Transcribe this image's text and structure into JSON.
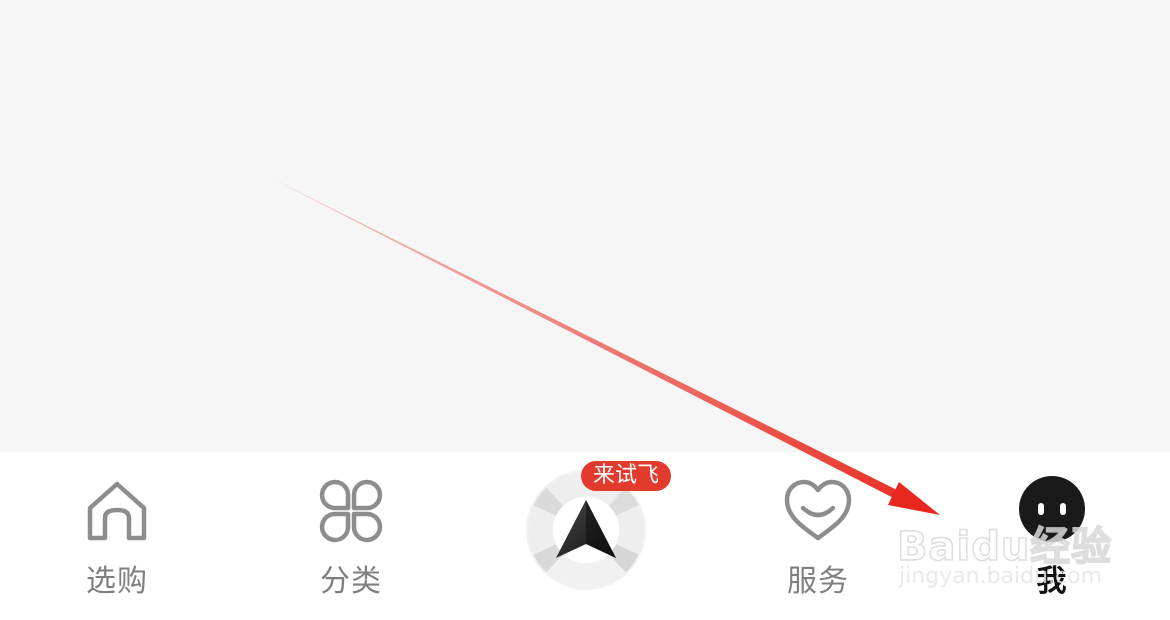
{
  "tabbar": {
    "items": [
      {
        "id": "home",
        "label": "选购",
        "icon": "home-icon",
        "active": false
      },
      {
        "id": "category",
        "label": "分类",
        "icon": "four-petal-grid-icon",
        "active": false
      },
      {
        "id": "center",
        "badge": "来试飞",
        "icon": "navigation-arrow-icon"
      },
      {
        "id": "service",
        "label": "服务",
        "icon": "heart-smile-icon",
        "active": false
      },
      {
        "id": "me",
        "label": "我",
        "icon": "avatar-face-icon",
        "active": true
      }
    ]
  },
  "watermark": {
    "brand": "Baidu经验",
    "url": "jingyan.baidu.com"
  },
  "colors": {
    "background": "#f6f6f6",
    "tabbar": "#ffffff",
    "inactive_label": "#7f7f7f",
    "active_label": "#111111",
    "badge": "#e23a2c",
    "annotation_arrow": "#e8281e"
  }
}
